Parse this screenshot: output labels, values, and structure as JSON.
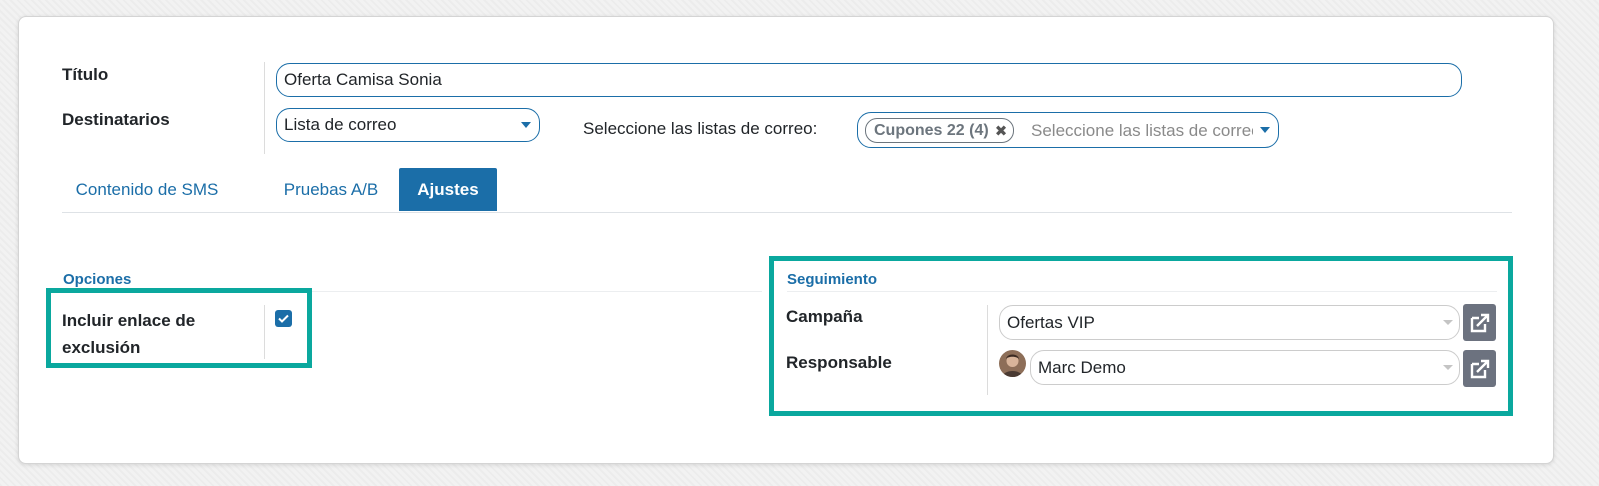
{
  "form": {
    "title_label": "Título",
    "title_value": "Oferta Camisa Sonia",
    "recipients_label": "Destinatarios",
    "recipients_value": "Lista de correo",
    "mailing_lists_label": "Seleccione las listas de correo:",
    "mailing_list_tag": "Cupones 22 (4)",
    "mailing_list_placeholder": "Seleccione las listas de correo"
  },
  "tabs": [
    {
      "label": "Contenido de SMS",
      "active": false
    },
    {
      "label": "Pruebas A/B",
      "active": false
    },
    {
      "label": "Ajustes",
      "active": true
    }
  ],
  "options": {
    "title": "Opciones",
    "unsubscribe_label": "Incluir enlace de exclusión",
    "unsubscribe_checked": true
  },
  "tracking": {
    "title": "Seguimiento",
    "campaign_label": "Campaña",
    "campaign_value": "Ofertas VIP",
    "responsible_label": "Responsable",
    "responsible_value": "Marc Demo"
  },
  "colors": {
    "accent": "#1b6ea8",
    "highlight": "#0aa89e",
    "external_button": "#6c727f"
  }
}
